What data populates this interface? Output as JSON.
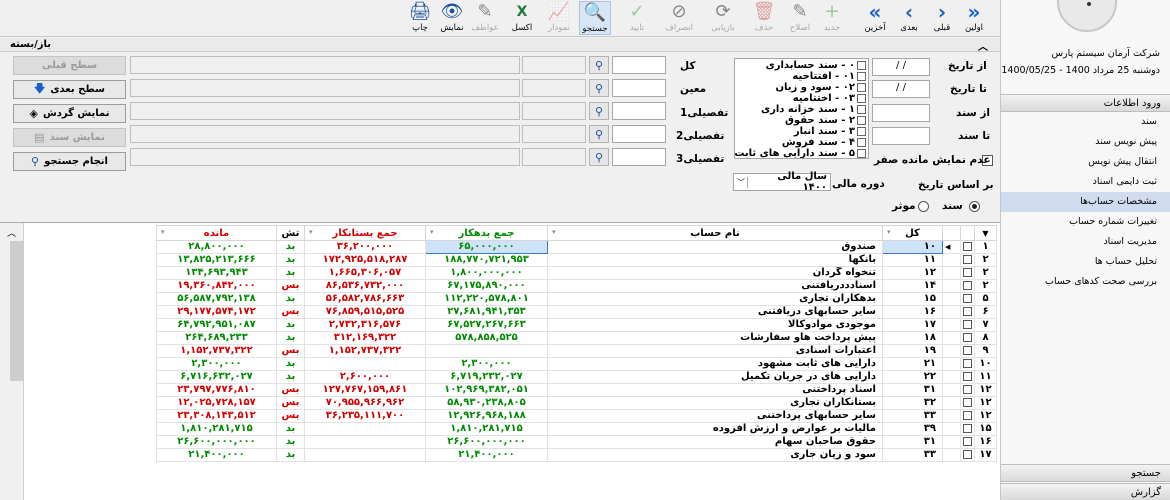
{
  "toolbar": {
    "buttons": [
      {
        "key": "first",
        "label": "اولین",
        "icon": "»",
        "state": "nav"
      },
      {
        "key": "prev",
        "label": "قبلی",
        "icon": "›",
        "state": "nav"
      },
      {
        "key": "next",
        "label": "بعدی",
        "icon": "‹",
        "state": "nav"
      },
      {
        "key": "last",
        "label": "آخرین",
        "icon": "«",
        "state": "nav"
      },
      {
        "key": "new",
        "label": "جدید",
        "icon": "+",
        "state": "disabled"
      },
      {
        "key": "edit",
        "label": "اصلاح",
        "icon": "✎",
        "state": "disabled"
      },
      {
        "key": "delete",
        "label": "حذف",
        "icon": "🗑",
        "state": "disabled"
      },
      {
        "key": "recover",
        "label": "بازیابی",
        "icon": "⟳",
        "state": "disabled"
      },
      {
        "key": "cancel",
        "label": "انصراف",
        "icon": "⊘",
        "state": "disabled"
      },
      {
        "key": "confirm",
        "label": "تایید",
        "icon": "✓",
        "state": "disabled"
      },
      {
        "key": "search",
        "label": "جستجو",
        "icon": "🔍",
        "state": "active"
      },
      {
        "key": "chart",
        "label": "نمودار",
        "icon": "📈",
        "state": "disabled"
      },
      {
        "key": "excel",
        "label": "اکسل",
        "icon": "X",
        "state": "normal"
      },
      {
        "key": "draw",
        "label": "عواطف",
        "icon": "✎",
        "state": "disabled"
      },
      {
        "key": "show",
        "label": "نمایش",
        "icon": "👁",
        "state": "normal"
      },
      {
        "key": "print",
        "label": "چاپ",
        "icon": "🖨",
        "state": "normal"
      }
    ]
  },
  "filter": {
    "title": "باز/بسته",
    "collapse_icon": "chevron-up",
    "labels": {
      "from_date": "از تاریخ",
      "to_date": "تا تاریخ",
      "from_doc": "از سند",
      "to_doc": "تا سند",
      "kol": "کل",
      "moein": "معین",
      "tafsili1": "تفصیلی1",
      "tafsili2": "تفصیلی2",
      "tafsili3": "تفصیلی3",
      "no_zero": "عدم نمایش مانده صفر",
      "based_on_date": "بر اساس تاریخ",
      "period": "دوره مالی",
      "radio_doc": "سند",
      "radio_effective": "موثر"
    },
    "values": {
      "from_date": "/ /",
      "to_date": "/ /",
      "period": "سال مالی ۱۴۰۰"
    },
    "doc_types": [
      "۰ - سند حسابداری",
      "۰۱ - افتتاحیه",
      "۰۲ - سود و زیان",
      "۰۳ - اختتامیه",
      "۱ - سند خزانه داری",
      "۲ - سند حقوق",
      "۳ - سند انبار",
      "۴ - سند فروش",
      "۵ - سند دارایی های ثابت"
    ],
    "actions": {
      "prev_level": "سطح قبلی",
      "next_level": "سطح بعدی",
      "show_turnover": "نمایش گردش",
      "show_doc": "نمایش سند",
      "do_search": "انجام جستجو"
    }
  },
  "grid": {
    "headers": {
      "kol": "کل",
      "account_name": "نام حساب",
      "debit_total": "جمع بدهکار",
      "credit_total": "جمع بستانکار",
      "nature": "تش",
      "balance": "مانده"
    },
    "rows": [
      {
        "row": "۱",
        "code": "۱۰",
        "name": "صندوق",
        "debit": "۶۵,۰۰۰,۰۰۰",
        "credit": "۳۶,۲۰۰,۰۰۰",
        "nature": "بد",
        "balance": "۲۸,۸۰۰,۰۰۰"
      },
      {
        "row": "۲",
        "code": "۱۱",
        "name": "بانکها",
        "debit": "۱۸۸,۷۷۰,۷۲۱,۹۵۳",
        "credit": "۱۷۲,۹۲۵,۵۱۸,۲۸۷",
        "nature": "بد",
        "balance": "۱۳,۸۲۵,۲۱۳,۶۶۶"
      },
      {
        "row": "۲",
        "code": "۱۲",
        "name": "تنخواه گردان",
        "debit": "۱,۸۰۰,۰۰۰,۰۰۰",
        "credit": "۱,۶۶۵,۳۰۶,۰۵۷",
        "nature": "بد",
        "balance": "۱۳۴,۶۹۳,۹۴۳"
      },
      {
        "row": "۲",
        "code": "۱۴",
        "name": "اسنادددریافتنی",
        "debit": "۶۷,۱۷۵,۸۹۰,۰۰۰",
        "credit": "۸۶,۵۳۶,۷۳۲,۰۰۰",
        "nature": "بس",
        "balance": "۱۹,۳۶۰,۸۴۲,۰۰۰"
      },
      {
        "row": "۵",
        "code": "۱۵",
        "name": "بدهکاران تجاری",
        "debit": "۱۱۲,۲۲۰,۵۷۸,۸۰۱",
        "credit": "۵۶,۵۸۲,۷۸۶,۶۶۳",
        "nature": "بد",
        "balance": "۵۶,۵۸۷,۷۹۲,۱۳۸"
      },
      {
        "row": "۶",
        "code": "۱۶",
        "name": "سایر حسابهای دریافتنی",
        "debit": "۲۷,۶۸۱,۹۴۱,۳۵۳",
        "credit": "۷۶,۸۵۹,۵۱۵,۵۲۵",
        "nature": "بس",
        "balance": "۲۹,۱۷۷,۵۷۴,۱۷۲"
      },
      {
        "row": "۷",
        "code": "۱۷",
        "name": "موجودی موادوکالا",
        "debit": "۶۷,۵۲۷,۲۶۷,۶۶۳",
        "credit": "۲,۷۳۲,۳۱۶,۵۷۶",
        "nature": "بد",
        "balance": "۶۴,۷۹۲,۹۵۱,۰۸۷"
      },
      {
        "row": "۸",
        "code": "۱۸",
        "name": "پیش پرداخت هاو سفارشات",
        "debit": "۵۷۸,۸۵۸,۵۲۵",
        "credit": "۳۱۲,۱۶۹,۳۲۲",
        "nature": "بد",
        "balance": "۲۶۴,۶۸۹,۲۳۳"
      },
      {
        "row": "۹",
        "code": "۱۹",
        "name": "اعتبارات اسنادی",
        "debit": "",
        "credit": "۱,۱۵۲,۷۳۷,۳۲۲",
        "nature": "بس",
        "balance": "۱,۱۵۲,۷۳۷,۳۲۲"
      },
      {
        "row": "۱۰",
        "code": "۲۱",
        "name": "دارایی های ثابت مشهود",
        "debit": "۲,۳۰۰,۰۰۰",
        "credit": "",
        "nature": "بد",
        "balance": "۲,۳۰۰,۰۰۰"
      },
      {
        "row": "۱۱",
        "code": "۲۲",
        "name": "دارایی های در جریان تکمیل",
        "debit": "۶,۷۱۹,۲۳۲,۰۲۷",
        "credit": "۲,۶۰۰,۰۰۰",
        "nature": "بد",
        "balance": "۶,۷۱۶,۶۳۲,۰۲۷"
      },
      {
        "row": "۱۲",
        "code": "۳۱",
        "name": "اسناد پرداختنی",
        "debit": "۱۰۲,۹۶۹,۳۸۲,۰۵۱",
        "credit": "۱۲۷,۷۶۷,۱۵۹,۸۶۱",
        "nature": "بس",
        "balance": "۲۳,۷۹۷,۷۷۶,۸۱۰"
      },
      {
        "row": "۱۲",
        "code": "۳۲",
        "name": "بستانکاران تجاری",
        "debit": "۵۸,۹۳۰,۲۳۸,۸۰۵",
        "credit": "۷۰,۹۵۵,۹۶۶,۹۶۲",
        "nature": "بس",
        "balance": "۱۲,۰۲۵,۷۲۸,۱۵۷"
      },
      {
        "row": "۱۲",
        "code": "۳۳",
        "name": "سایر حسابهای پرداختنی",
        "debit": "۱۲,۹۲۶,۹۶۸,۱۸۸",
        "credit": "۳۶,۲۳۵,۱۱۱,۷۰۰",
        "nature": "بس",
        "balance": "۲۳,۳۰۸,۱۴۳,۵۱۲"
      },
      {
        "row": "۱۵",
        "code": "۳۹",
        "name": "مالیات بر عوارض و ارزش افزوده",
        "debit": "۱,۸۱۰,۲۸۱,۷۱۵",
        "credit": "",
        "nature": "بد",
        "balance": "۱,۸۱۰,۲۸۱,۷۱۵"
      },
      {
        "row": "۱۶",
        "code": "۳۱",
        "name": "حقوق صاحبان سهام",
        "debit": "۲۶,۶۰۰,۰۰۰,۰۰۰",
        "credit": "",
        "nature": "بد",
        "balance": "۲۶,۶۰۰,۰۰۰,۰۰۰"
      },
      {
        "row": "۱۷",
        "code": "۳۳",
        "name": "سود و زیان جاری",
        "debit": "۲۱,۴۰۰,۰۰۰",
        "credit": "",
        "nature": "بد",
        "balance": "۲۱,۴۰۰,۰۰۰"
      }
    ]
  },
  "right_panel": {
    "company": "شرکت آرمان سیستم پارس",
    "date_line": "دوشنبه 25 مرداد 1400 - 1400/05/25",
    "section_title": "ورود اطلاعات",
    "menu": [
      {
        "label": "سند",
        "active": false
      },
      {
        "label": "پیش نویس سند",
        "active": false
      },
      {
        "label": "انتقال پیش نویس",
        "active": false
      },
      {
        "label": "ثبت دایمی اسناد",
        "active": false
      },
      {
        "label": "مشخصات حساب‌ها",
        "active": true
      },
      {
        "label": "تغییرات شماره حساب",
        "active": false
      },
      {
        "label": "مدیریت اسناد",
        "active": false
      },
      {
        "label": "تحلیل حساب ها",
        "active": false
      },
      {
        "label": "بررسی صحت کدهای حساب",
        "active": false
      }
    ],
    "footer_sections": [
      "جستجو",
      "گزارش"
    ]
  },
  "colors": {
    "debit": "#008a00",
    "credit": "#d20000",
    "nav_blue": "#1a5fc8",
    "selected_row": "#cfe3f8",
    "active_menu": "#cfdbef"
  }
}
